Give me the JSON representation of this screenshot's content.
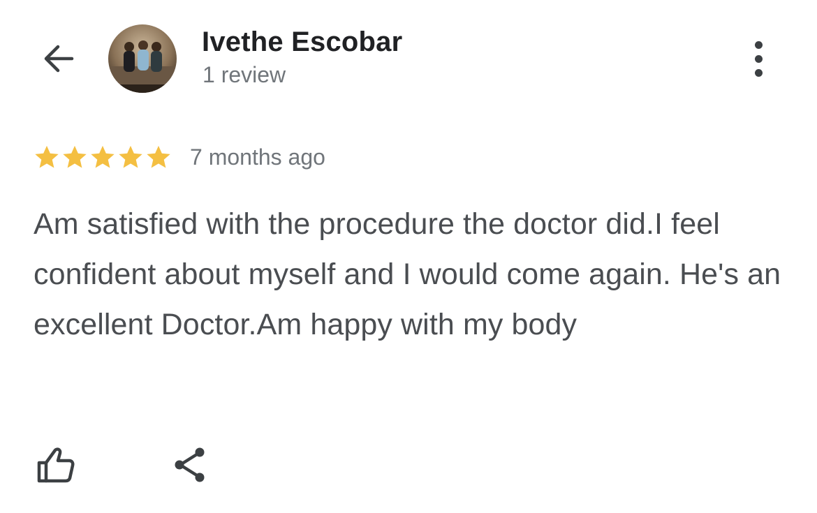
{
  "header": {
    "back_icon": "arrow-left-icon",
    "reviewer_name": "Ivethe Escobar",
    "review_count": "1 review",
    "more_icon": "more-vertical-icon"
  },
  "review": {
    "rating": 5,
    "rating_max": 5,
    "star_color": "#f4bf42",
    "date": "7 months ago",
    "text": "Am satisfied with the procedure the doctor did.I feel confident about myself and I would come again. He's an excellent Doctor.Am happy with my body"
  },
  "actions": {
    "like_icon": "thumbs-up-icon",
    "share_icon": "share-icon"
  },
  "colors": {
    "text_primary": "#202124",
    "text_secondary": "#70757a",
    "icon": "#3c4043"
  }
}
